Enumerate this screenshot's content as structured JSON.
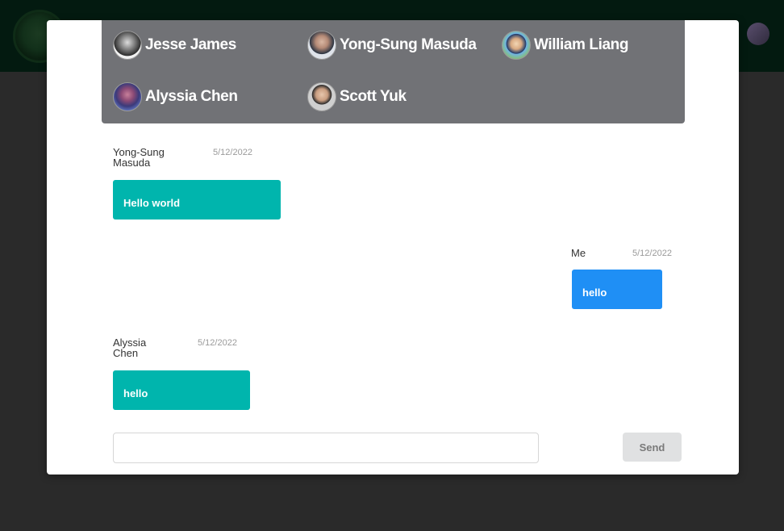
{
  "members": [
    {
      "name": "Jesse James",
      "avatar_icon": "jesse-avatar"
    },
    {
      "name": "Yong-Sung Masuda",
      "avatar_icon": "yong-avatar"
    },
    {
      "name": "William Liang",
      "avatar_icon": "william-avatar"
    },
    {
      "name": "Alyssia Chen",
      "avatar_icon": "alyssia-avatar"
    },
    {
      "name": "Scott Yuk",
      "avatar_icon": "scott-avatar"
    }
  ],
  "messages": [
    {
      "author": "Yong-Sung Masuda",
      "date": "5/12/2022",
      "text": "Hello world"
    },
    {
      "author": "Me",
      "date": "5/12/2022",
      "text": "hello"
    },
    {
      "author": "Alyssia Chen",
      "date": "5/12/2022",
      "text": "hello"
    }
  ],
  "composer": {
    "placeholder": "",
    "value": "",
    "send_label": "Send"
  },
  "colors": {
    "incoming": "#00b5ad",
    "outgoing": "#1f8ff5",
    "members_bar": "#717276",
    "overlay": "#2a2a2a"
  }
}
